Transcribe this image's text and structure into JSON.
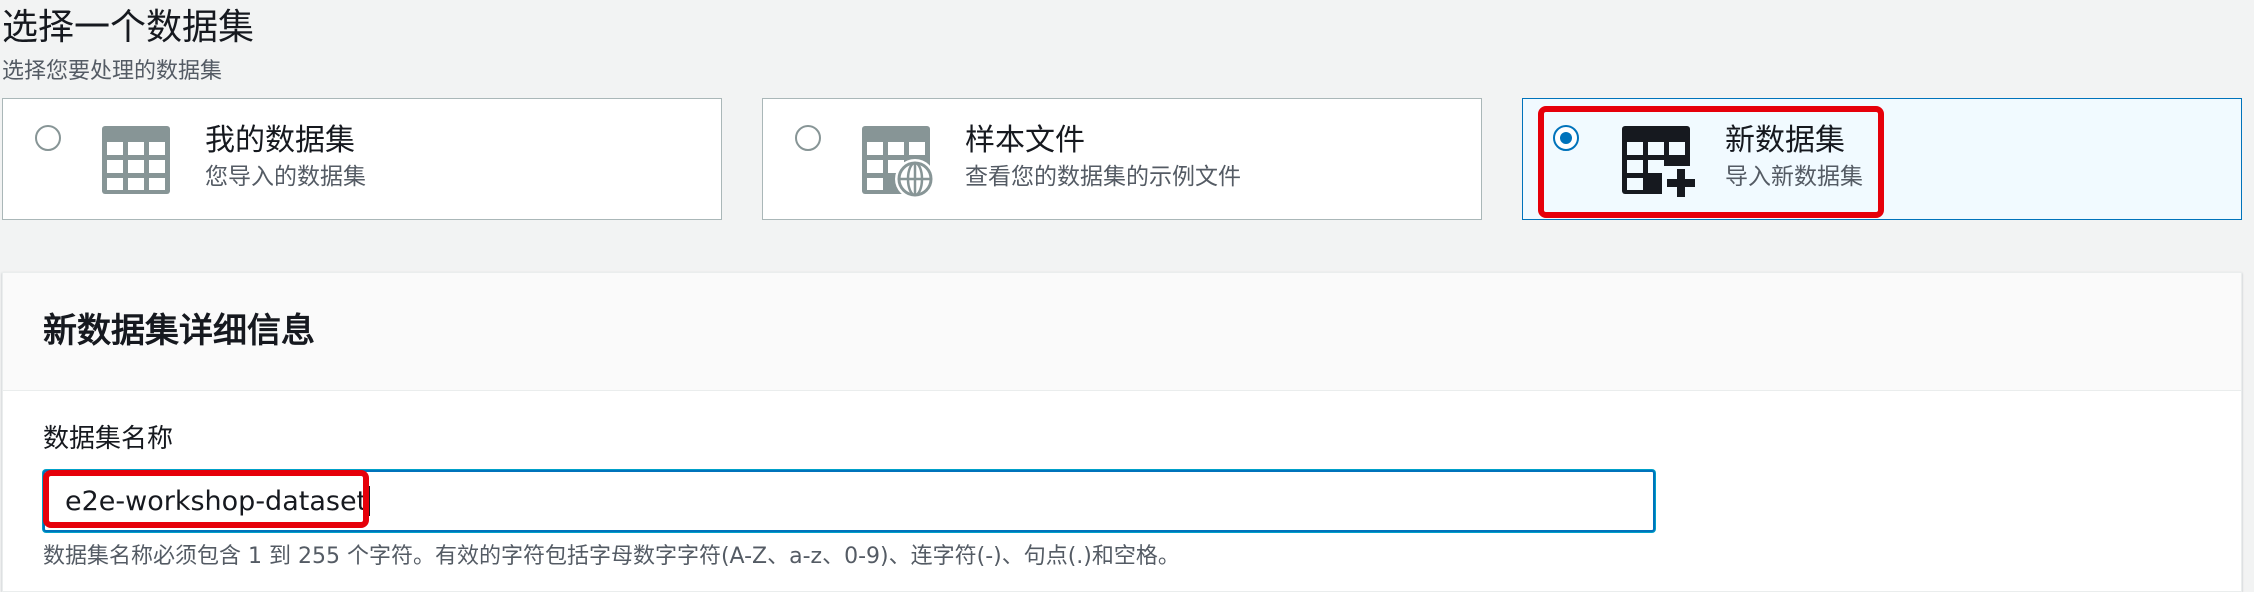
{
  "header": {
    "title": "选择一个数据集",
    "subtitle": "选择您要处理的数据集"
  },
  "dataset_options": [
    {
      "title": "我的数据集",
      "description": "您导入的数据集",
      "icon": "table-icon",
      "selected": false
    },
    {
      "title": "样本文件",
      "description": "查看您的数据集的示例文件",
      "icon": "table-globe-icon",
      "selected": false
    },
    {
      "title": "新数据集",
      "description": "导入新数据集",
      "icon": "table-add-icon",
      "selected": true
    }
  ],
  "details_panel": {
    "title": "新数据集详细信息",
    "name_field": {
      "label": "数据集名称",
      "value": "e2e-workshop-dataset",
      "constraint": "数据集名称必须包含 1 到 255 个字符。有效的字符包括字母数字字符(A-Z、a-z、0-9)、连字符(-)、句点(.)和空格。"
    }
  },
  "colors": {
    "accent": "#0073bb",
    "highlight": "#e6000a",
    "selected_tile_bg": "#f1faff",
    "page_bg": "#f2f3f3"
  }
}
